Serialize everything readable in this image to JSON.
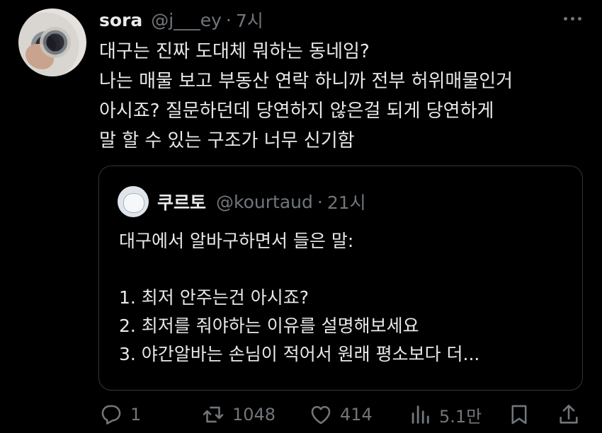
{
  "tweet": {
    "author_name": "sora",
    "author_handle": "@j___ey",
    "separator": "·",
    "time": "7시",
    "lines": [
      "대구는 진짜 도대체 뭐하는 동네임?",
      "나는 매물 보고 부동산 연락 하니까 전부 허위매물인거",
      "아시죠? 질문하던데 당연하지 않은걸 되게 당연하게",
      "말 할 수 있는 구조가 너무 신기함"
    ]
  },
  "quote": {
    "author_name": "쿠르토",
    "author_handle": "@kourtaud",
    "separator": "·",
    "time": "21시",
    "lines": [
      "대구에서 알바구하면서 들은 말:",
      "",
      "1. 최저 안주는건 아시죠?",
      "2. 최저를 줘야하는 이유를 설명해보세요",
      "3. 야간알바는 손님이 적어서 원래 평소보다 더..."
    ]
  },
  "actions": {
    "reply_count": "1",
    "repost_count": "1048",
    "like_count": "414",
    "views_count": "5.1만"
  },
  "icons": [
    "more-icon",
    "reply-icon",
    "repost-icon",
    "like-icon",
    "views-icon",
    "bookmark-icon",
    "share-icon"
  ],
  "colors": {
    "background": "#000000",
    "text": "#e7e9ea",
    "secondary": "#71767b",
    "border": "#333639"
  }
}
